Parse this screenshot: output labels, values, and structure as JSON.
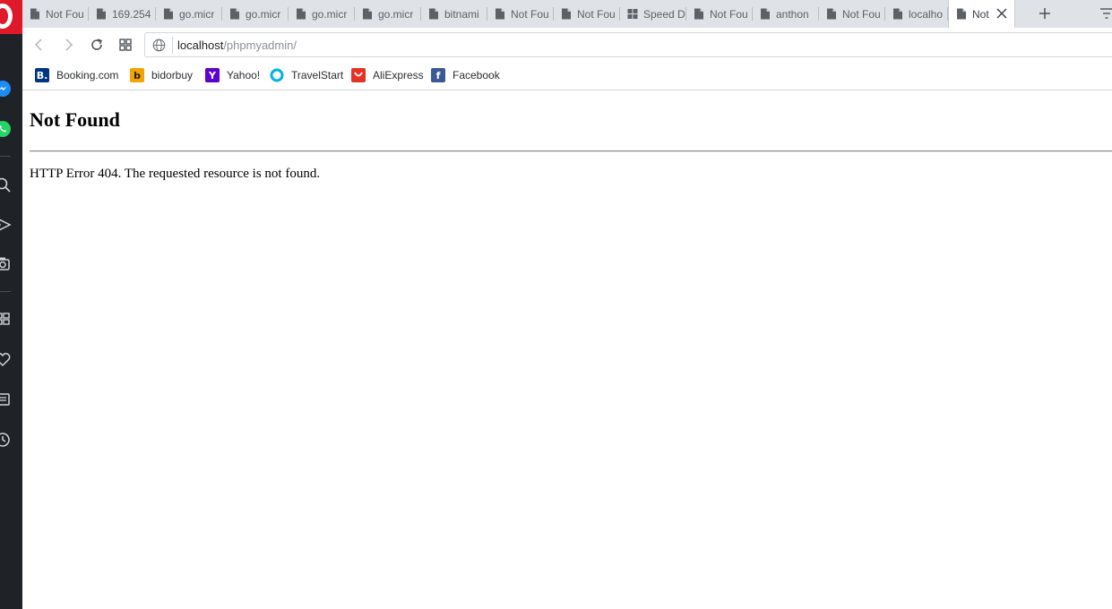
{
  "tabs": [
    {
      "title": "Not Fou",
      "icon": "page-icon"
    },
    {
      "title": "169.254",
      "icon": "page-icon"
    },
    {
      "title": "go.micr",
      "icon": "page-icon"
    },
    {
      "title": "go.micr",
      "icon": "page-icon"
    },
    {
      "title": "go.micr",
      "icon": "page-icon"
    },
    {
      "title": "go.micr",
      "icon": "page-icon"
    },
    {
      "title": "bitnami",
      "icon": "page-icon"
    },
    {
      "title": "Not Fou",
      "icon": "page-icon"
    },
    {
      "title": "Not Fou",
      "icon": "page-icon"
    },
    {
      "title": "Speed D",
      "icon": "speed-dial-icon"
    },
    {
      "title": "Not Fou",
      "icon": "page-icon"
    },
    {
      "title": "anthon",
      "icon": "page-icon"
    },
    {
      "title": "Not Fou",
      "icon": "page-icon"
    },
    {
      "title": "localho",
      "icon": "page-icon"
    },
    {
      "title": "Not",
      "icon": "page-icon",
      "active": true
    }
  ],
  "address_bar": {
    "host": "localhost",
    "path": "/phpmyadmin/"
  },
  "bookmarks": [
    {
      "label": "Booking.com",
      "icon": "booking-icon",
      "glyph": "B.",
      "color": "#003580"
    },
    {
      "label": "bidorbuy",
      "icon": "bidorbuy-icon",
      "glyph": "b",
      "color": "#f5a300"
    },
    {
      "label": "Yahoo!",
      "icon": "yahoo-icon",
      "glyph": "Y",
      "color": "#5f01d1"
    },
    {
      "label": "TravelStart",
      "icon": "travelstart-icon",
      "glyph": "",
      "color": "#00b3e3"
    },
    {
      "label": "AliExpress",
      "icon": "aliexpress-icon",
      "glyph": "",
      "color": "#e43225"
    },
    {
      "label": "Facebook",
      "icon": "facebook-icon",
      "glyph": "f",
      "color": "#3b5998"
    }
  ],
  "page": {
    "heading": "Not Found",
    "message": "HTTP Error 404. The requested resource is not found."
  },
  "colors": {
    "opera_red": "#e0192a",
    "sidebar_bg": "#1f2226",
    "tabstrip_bg": "#dfe3e8"
  }
}
